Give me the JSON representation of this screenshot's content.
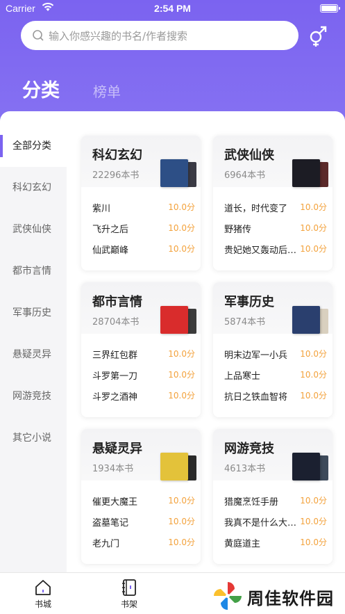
{
  "status": {
    "carrier": "Carrier",
    "time": "2:54 PM"
  },
  "search": {
    "placeholder": "输入你感兴趣的书名/作者搜索"
  },
  "tabs": {
    "category": "分类",
    "ranking": "榜单"
  },
  "sidebar": {
    "items": [
      {
        "label": "全部分类",
        "active": true
      },
      {
        "label": "科幻玄幻"
      },
      {
        "label": "武侠仙侠"
      },
      {
        "label": "都市言情"
      },
      {
        "label": "军事历史"
      },
      {
        "label": "悬疑灵异"
      },
      {
        "label": "网游竞技"
      },
      {
        "label": "其它小说"
      }
    ]
  },
  "cards": [
    {
      "title": "科幻玄幻",
      "count": "22296本书",
      "books": [
        {
          "name": "紫川",
          "score": "10.0分"
        },
        {
          "name": "飞升之后",
          "score": "10.0分"
        },
        {
          "name": "仙武巅峰",
          "score": "10.0分"
        }
      ],
      "cover_color": "#2d4f86",
      "cover_back": "#3a3a44"
    },
    {
      "title": "武侠仙侠",
      "count": "6964本书",
      "books": [
        {
          "name": "道长，时代变了",
          "score": "10.0分"
        },
        {
          "name": "野猪传",
          "score": "10.0分"
        },
        {
          "name": "贵妃她又轰动后…",
          "score": "10.0分"
        }
      ],
      "cover_color": "#1c1c24",
      "cover_back": "#5b2a2a"
    },
    {
      "title": "都市言情",
      "count": "28704本书",
      "books": [
        {
          "name": "三界红包群",
          "score": "10.0分"
        },
        {
          "name": "斗罗第一刀",
          "score": "10.0分"
        },
        {
          "name": "斗罗之酒神",
          "score": "10.0分"
        }
      ],
      "cover_color": "#d92c2c",
      "cover_back": "#3c3c3c"
    },
    {
      "title": "军事历史",
      "count": "5874本书",
      "books": [
        {
          "name": "明末边军一小兵",
          "score": "10.0分"
        },
        {
          "name": "上品寒士",
          "score": "10.0分"
        },
        {
          "name": "抗日之铁血智将",
          "score": "10.0分"
        }
      ],
      "cover_color": "#2a3f6e",
      "cover_back": "#d9d0bf"
    },
    {
      "title": "悬疑灵异",
      "count": "1934本书",
      "books": [
        {
          "name": "催更大魔王",
          "score": "10.0分"
        },
        {
          "name": "盗墓笔记",
          "score": "10.0分"
        },
        {
          "name": "老九门",
          "score": "10.0分"
        }
      ],
      "cover_color": "#e3c23a",
      "cover_back": "#2a2a2a"
    },
    {
      "title": "网游竞技",
      "count": "4613本书",
      "books": [
        {
          "name": "猎魔烹饪手册",
          "score": "10.0分"
        },
        {
          "name": "我真不是什么大…",
          "score": "10.0分"
        },
        {
          "name": "黄庭道主",
          "score": "10.0分"
        }
      ],
      "cover_color": "#1b2030",
      "cover_back": "#3d4a5a"
    }
  ],
  "tabbar": {
    "bookstore": "书城",
    "bookshelf": "书架"
  },
  "watermark": {
    "text": "周佳软件园"
  },
  "colors": {
    "accent": "#7b63f0",
    "score": "#f3a23c"
  }
}
